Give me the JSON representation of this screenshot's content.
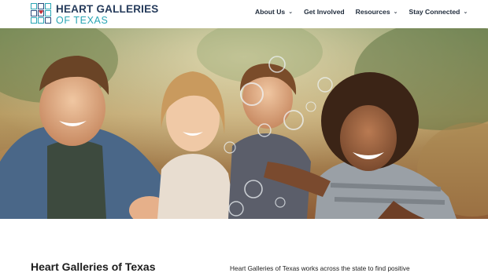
{
  "header": {
    "logo_line1": "HEART GALLERIES",
    "logo_line2": "OF TEXAS"
  },
  "nav": {
    "items": [
      {
        "label": "About Us",
        "has_dropdown": true
      },
      {
        "label": "Get Involved",
        "has_dropdown": false
      },
      {
        "label": "Resources",
        "has_dropdown": true
      },
      {
        "label": "Stay Connected",
        "has_dropdown": true
      }
    ],
    "chevron": "⌄"
  },
  "hero": {
    "image": "photo-of-four-smiling-children-with-bubbles"
  },
  "content": {
    "title": "Heart Galleries of Texas",
    "text": "Heart Galleries of Texas works across the state to find positive"
  },
  "colors": {
    "navy": "#253b5b",
    "teal": "#2aa6b4",
    "heart_red": "#c8323a",
    "nav_text": "#1e2a3a"
  }
}
